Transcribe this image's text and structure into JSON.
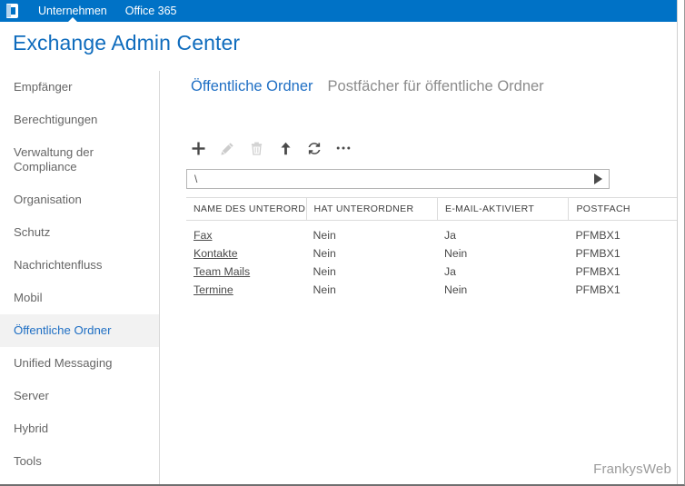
{
  "suitebar": {
    "logo_icon": "office-logo-icon",
    "tabs": [
      {
        "label": "Unternehmen",
        "active": true
      },
      {
        "label": "Office 365",
        "active": false
      }
    ]
  },
  "header": {
    "product_title": "Exchange Admin Center"
  },
  "sidebar": {
    "items": [
      {
        "label": "Empfänger",
        "active": false,
        "two_line": false
      },
      {
        "label": "Berechtigungen",
        "active": false,
        "two_line": false
      },
      {
        "label": "Verwaltung der Compliance",
        "active": false,
        "two_line": true
      },
      {
        "label": "Organisation",
        "active": false,
        "two_line": false
      },
      {
        "label": "Schutz",
        "active": false,
        "two_line": false
      },
      {
        "label": "Nachrichtenfluss",
        "active": false,
        "two_line": false
      },
      {
        "label": "Mobil",
        "active": false,
        "two_line": false
      },
      {
        "label": "Öffentliche Ordner",
        "active": true,
        "two_line": false
      },
      {
        "label": "Unified Messaging",
        "active": false,
        "two_line": false
      },
      {
        "label": "Server",
        "active": false,
        "two_line": false
      },
      {
        "label": "Hybrid",
        "active": false,
        "two_line": false
      },
      {
        "label": "Tools",
        "active": false,
        "two_line": false
      }
    ]
  },
  "main": {
    "tabs": [
      {
        "label": "Öffentliche Ordner",
        "active": true
      },
      {
        "label": "Postfächer für öffentliche Ordner",
        "active": false
      }
    ],
    "toolbar": [
      {
        "name": "add-button",
        "icon": "plus-icon",
        "enabled": true
      },
      {
        "name": "edit-button",
        "icon": "pencil-icon",
        "enabled": false
      },
      {
        "name": "delete-button",
        "icon": "trash-icon",
        "enabled": false
      },
      {
        "name": "move-up-button",
        "icon": "arrow-up-icon",
        "enabled": true
      },
      {
        "name": "refresh-button",
        "icon": "refresh-icon",
        "enabled": true
      },
      {
        "name": "more-button",
        "icon": "ellipsis-icon",
        "enabled": true
      }
    ],
    "pathbar": {
      "value": "\\",
      "placeholder": "\\",
      "go_icon": "play-triangle-icon"
    },
    "table": {
      "columns": [
        {
          "label": "Name des Unterordne…",
          "sorted": "asc"
        },
        {
          "label": "Hat Unterordner",
          "sorted": ""
        },
        {
          "label": "E-Mail-aktiviert",
          "sorted": ""
        },
        {
          "label": "Postfach",
          "sorted": ""
        }
      ],
      "rows": [
        {
          "name": "Fax",
          "has_subfolders": "Nein",
          "mail_enabled": "Ja",
          "mailbox": "PFMBX1"
        },
        {
          "name": "Kontakte",
          "has_subfolders": "Nein",
          "mail_enabled": "Nein",
          "mailbox": "PFMBX1"
        },
        {
          "name": "Team Mails",
          "has_subfolders": "Nein",
          "mail_enabled": "Ja",
          "mailbox": "PFMBX1"
        },
        {
          "name": "Termine",
          "has_subfolders": "Nein",
          "mail_enabled": "Nein",
          "mailbox": "PFMBX1"
        }
      ]
    }
  },
  "watermark": {
    "label": "FrankysWeb"
  },
  "colors": {
    "suitebar_blue": "#0072c6",
    "accent_blue": "#1f6fc4",
    "title_blue": "#0f6cbd",
    "text_grey": "#666666",
    "active_nav_bg": "#f2f2f2",
    "border_grey": "#dcdcdc"
  }
}
